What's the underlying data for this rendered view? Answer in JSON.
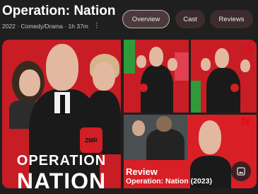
{
  "header": {
    "title": "Operation: Nation",
    "meta": "2022 · Comedy/Drama · 1h 37m",
    "more_icon": "⋮"
  },
  "tabs": [
    {
      "label": "Overview",
      "active": true
    },
    {
      "label": "Cast",
      "active": false
    },
    {
      "label": "Reviews",
      "active": false
    }
  ],
  "gallery": {
    "poster": {
      "line1": "OPERATION",
      "line2": "NATION",
      "armband": "ZMR"
    },
    "stills": [
      {
        "logo": "N"
      },
      {
        "logo": "N"
      }
    ],
    "review_card": {
      "label": "Review",
      "subtitle": "Operation: Nation (2023)",
      "logo": "N"
    },
    "image_button_icon": "image-icon"
  },
  "colors": {
    "background": "#1f1f1f",
    "accent_red": "#c81d25",
    "review_yellow": "#fdd835"
  }
}
